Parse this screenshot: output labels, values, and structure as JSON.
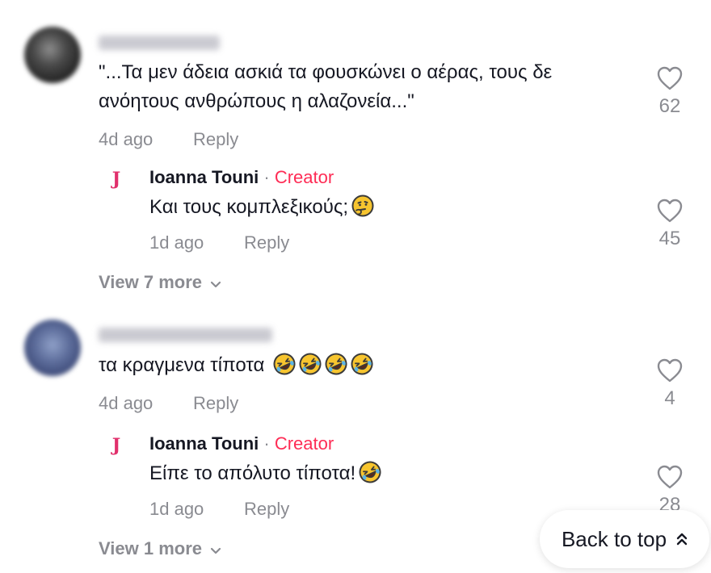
{
  "comments": [
    {
      "text_line1": "\"...Τα μεν άδεια ασκιά τα φουσκώνει ο αέρας, τους δε",
      "text_line2": "ανόητους ανθρώπους η αλαζονεία...\"",
      "time": "4d ago",
      "reply_label": "Reply",
      "likes": "62",
      "reply": {
        "author": "Ioanna Touni",
        "separator": "·",
        "badge": "Creator",
        "text": "Και τους κομπλεξικούς;",
        "emoji": [
          "thinking-face"
        ],
        "time": "1d ago",
        "reply_label": "Reply",
        "likes": "45"
      },
      "view_more": "View 7 more"
    },
    {
      "text": "τα κραγμενα τίποτα",
      "emoji": [
        "rofl",
        "rofl",
        "rofl",
        "rofl"
      ],
      "time": "4d ago",
      "reply_label": "Reply",
      "likes": "4",
      "reply": {
        "author": "Ioanna Touni",
        "separator": "·",
        "badge": "Creator",
        "text": "Είπε το απόλυτο τίποτα!",
        "emoji": [
          "rofl"
        ],
        "time": "1d ago",
        "reply_label": "Reply",
        "likes": "28"
      },
      "view_more": "View 1 more"
    }
  ],
  "back_to_top": "Back to top",
  "colors": {
    "creator": "#fe2c55",
    "muted": "#8a8b91",
    "text": "#161823"
  }
}
